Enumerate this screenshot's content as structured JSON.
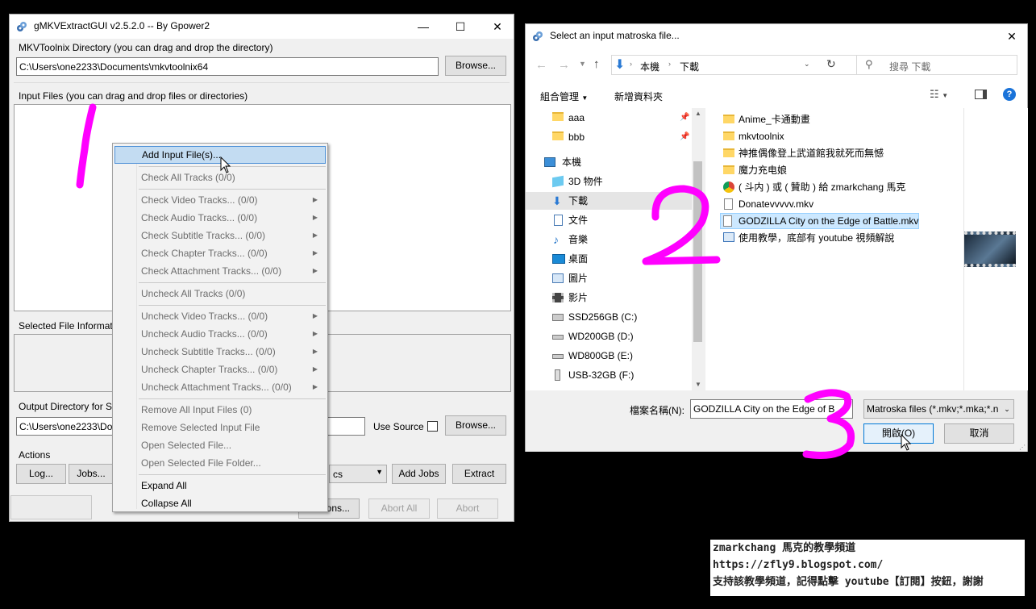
{
  "app_window": {
    "title": "gMKVExtractGUI v2.5.2.0 -- By Gpower2",
    "minimize": "—",
    "maximize": "☐",
    "close": "✕",
    "mkvtoolnix_label": "MKVToolnix Directory (you can drag and drop the directory)",
    "mkvtoolnix_path": "C:\\Users\\one2233\\Documents\\mkvtoolnix64",
    "browse_label": "Browse...",
    "input_files_label": "Input Files (you can drag and drop files or directories)",
    "selected_info_label": "Selected File Informati",
    "output_dir_label": "Output Directory for S",
    "output_dir_value": "C:\\Users\\one2233\\Dov",
    "use_source_label": "Use Source",
    "actions_label": "Actions",
    "log_label": "Log...",
    "jobs_label": "Jobs...",
    "mode_value": "cs",
    "add_jobs_label": "Add Jobs",
    "extract_label": "Extract",
    "options_label": "ions...",
    "abort_all_label": "Abort All",
    "abort_label": "Abort"
  },
  "context_menu": {
    "items": [
      {
        "label": "Add Input File(s)...",
        "enabled": true,
        "submenu": false
      },
      {
        "label": "Check All Tracks (0/0)",
        "enabled": false,
        "submenu": false
      },
      {
        "label": "Check Video Tracks... (0/0)",
        "enabled": false,
        "submenu": true
      },
      {
        "label": "Check Audio Tracks... (0/0)",
        "enabled": false,
        "submenu": true
      },
      {
        "label": "Check Subtitle Tracks... (0/0)",
        "enabled": false,
        "submenu": true
      },
      {
        "label": "Check Chapter Tracks... (0/0)",
        "enabled": false,
        "submenu": true
      },
      {
        "label": "Check Attachment Tracks... (0/0)",
        "enabled": false,
        "submenu": true
      },
      {
        "label": "Uncheck All Tracks (0/0)",
        "enabled": false,
        "submenu": false
      },
      {
        "label": "Uncheck Video Tracks... (0/0)",
        "enabled": false,
        "submenu": true
      },
      {
        "label": "Uncheck Audio Tracks... (0/0)",
        "enabled": false,
        "submenu": true
      },
      {
        "label": "Uncheck Subtitle Tracks... (0/0)",
        "enabled": false,
        "submenu": true
      },
      {
        "label": "Uncheck Chapter Tracks... (0/0)",
        "enabled": false,
        "submenu": true
      },
      {
        "label": "Uncheck Attachment Tracks... (0/0)",
        "enabled": false,
        "submenu": true
      },
      {
        "label": "Remove All Input Files (0)",
        "enabled": false,
        "submenu": false
      },
      {
        "label": "Remove Selected Input File",
        "enabled": false,
        "submenu": false
      },
      {
        "label": "Open Selected File...",
        "enabled": false,
        "submenu": false
      },
      {
        "label": "Open Selected File Folder...",
        "enabled": false,
        "submenu": false
      },
      {
        "label": "Expand All",
        "enabled": true,
        "submenu": false
      },
      {
        "label": "Collapse All",
        "enabled": true,
        "submenu": false
      }
    ]
  },
  "dialog": {
    "title": "Select an input matroska file...",
    "breadcrumb": [
      "本機",
      "下載"
    ],
    "search_placeholder": "搜尋 下載",
    "organize_label": "組合管理",
    "new_folder_label": "新增資料夾",
    "tree": [
      {
        "label": "aaa",
        "icon": "folder-icon",
        "pinned": true
      },
      {
        "label": "bbb",
        "icon": "folder-icon",
        "pinned": true
      },
      {
        "label": "本機",
        "icon": "computer-icon"
      },
      {
        "label": "3D 物件",
        "icon": "3d-objects-icon"
      },
      {
        "label": "下載",
        "icon": "downloads-icon",
        "selected": true
      },
      {
        "label": "文件",
        "icon": "documents-icon"
      },
      {
        "label": "音樂",
        "icon": "music-icon"
      },
      {
        "label": "桌面",
        "icon": "desktop-icon"
      },
      {
        "label": "圖片",
        "icon": "pictures-icon"
      },
      {
        "label": "影片",
        "icon": "videos-icon"
      },
      {
        "label": "SSD256GB (C:)",
        "icon": "drive-icon"
      },
      {
        "label": "WD200GB (D:)",
        "icon": "drive-icon"
      },
      {
        "label": "WD800GB (E:)",
        "icon": "drive-icon"
      },
      {
        "label": "USB-32GB (F:)",
        "icon": "usb-drive-icon"
      }
    ],
    "files": [
      {
        "label": "Anime_卡通動畫",
        "icon": "folder-icon"
      },
      {
        "label": "mkvtoolnix",
        "icon": "folder-icon"
      },
      {
        "label": "神推偶像登上武道館我就死而無憾",
        "icon": "folder-icon"
      },
      {
        "label": "魔力充电娘",
        "icon": "folder-icon"
      },
      {
        "label": "( 斗内 ) 或 ( 贊助 ) 給 zmarkchang 馬克",
        "icon": "chrome-shortcut-icon"
      },
      {
        "label": "Donatevvvvv.mkv",
        "icon": "file-icon"
      },
      {
        "label": "GODZILLA City on the Edge of Battle.mkv",
        "icon": "video-file-icon",
        "selected": true
      },
      {
        "label": "使用教學，底部有 youtube 視頻解說",
        "icon": "document-icon"
      }
    ],
    "filename_label": "檔案名稱(N):",
    "filename_value": "GODZILLA City on the Edge of B",
    "filter_value": "Matroska files (*.mkv;*.mka;*.n",
    "open_label": "開啟(O)",
    "cancel_label": "取消"
  },
  "annotations": {
    "step1": "1",
    "step2": "2",
    "step3": "3",
    "color": "#ff00ff"
  },
  "watermark": {
    "line1": "zmarkchang 馬克的教學頻道",
    "line2": "https://zfly9.blogspot.com/",
    "line3": "支持該教學頻道，記得點擊 youtube【訂閱】按鈕，謝謝"
  }
}
